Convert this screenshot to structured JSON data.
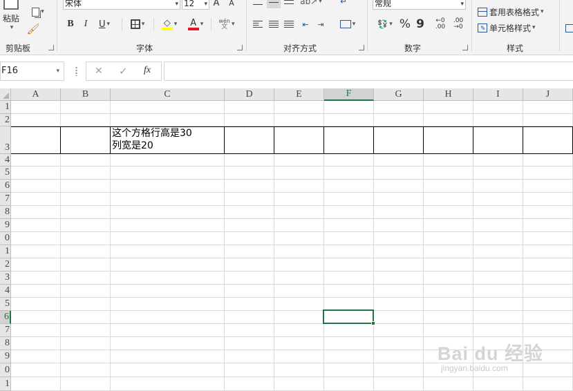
{
  "ribbon": {
    "clipboard": {
      "paste_label": "粘贴",
      "group_label": "剪贴板"
    },
    "font": {
      "name": "宋体",
      "size": "12",
      "bold": "B",
      "italic": "I",
      "underline": "U",
      "grow": "A",
      "shrink": "A",
      "phonetic": "wén",
      "group_label": "字体"
    },
    "alignment": {
      "group_label": "对齐方式"
    },
    "number": {
      "format": "常规",
      "percent": "%",
      "comma": "9",
      "inc_decimal": ".00",
      "dec_decimal": ".00",
      "group_label": "数字"
    },
    "styles": {
      "table_format": "套用表格格式",
      "cell_styles": "单元格样式",
      "group_label": "样式"
    }
  },
  "formula_bar": {
    "name_box": "F16",
    "cancel_icon": "✕",
    "enter_icon": "✓",
    "fx": "fx",
    "content": ""
  },
  "columns": [
    "A",
    "B",
    "C",
    "D",
    "E",
    "F",
    "G",
    "H",
    "I",
    "J"
  ],
  "rows": [
    "1",
    "2",
    "3",
    "4",
    "5",
    "6",
    "7",
    "8",
    "9",
    "0",
    "1",
    "2",
    "3",
    "4",
    "5",
    "6",
    "7",
    "8",
    "9",
    "0",
    "1"
  ],
  "selected_column": "F",
  "selected_row_index": 15,
  "cell_c3": "这个方格行高是30\n列宽是20",
  "watermark": {
    "brand": "Bai du 经验",
    "url": "jingyan.baidu.com"
  },
  "colors": {
    "accent": "#217346",
    "font_color": "#e81123",
    "highlight": "#ffff00"
  }
}
